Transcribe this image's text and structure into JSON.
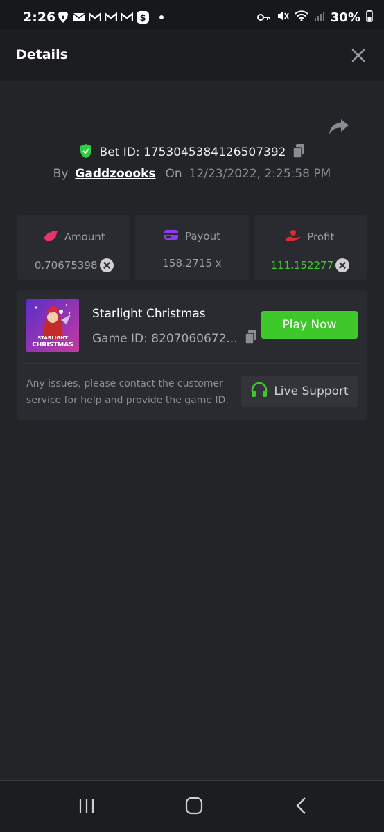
{
  "status_bar": {
    "time": "2:26",
    "left_icons": [
      "brave-icon",
      "mail-icon",
      "gmail-icon",
      "gmail-icon",
      "gmail-icon",
      "cash-app-icon"
    ],
    "battery": "30%"
  },
  "header": {
    "title": "Details"
  },
  "bet": {
    "id_label": "Bet ID: 1753045384126507392",
    "by_label": "By",
    "username": "Gaddzoooks",
    "on_label": "On",
    "datetime": "12/23/2022, 2:25:58 PM"
  },
  "stats": [
    {
      "label": "Amount",
      "value": "0.70675398",
      "icon": "amount-icon",
      "color": "#e8336b"
    },
    {
      "label": "Payout",
      "value": "158.2715 x",
      "icon": "payout-icon",
      "color": "#8b3cf0"
    },
    {
      "label": "Profit",
      "value": "111.152277",
      "icon": "profit-icon",
      "color": "#e02b2b"
    }
  ],
  "game": {
    "name": "Starlight Christmas",
    "id_label": "Game ID: 8207060672...",
    "thumb_line1": "STARLIGHT",
    "thumb_line2": "CHRISTMAS",
    "play_label": "Play Now",
    "support_text": "Any issues, please contact the customer service for help and provide the game ID.",
    "support_label": "Live Support"
  },
  "colors": {
    "accent_green": "#3fc82a",
    "profit_green": "#3fcf2c",
    "shield_green": "#2ecc40"
  }
}
